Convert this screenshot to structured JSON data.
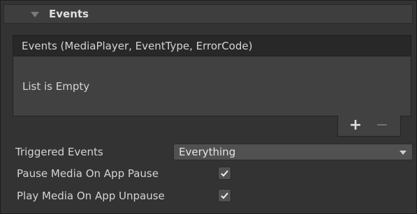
{
  "foldout": {
    "title": "Events",
    "expanded": true,
    "icon": "triangle-down-icon"
  },
  "events_list": {
    "header": "Events (MediaPlayer, EventType, ErrorCode)",
    "empty_text": "List is Empty",
    "add_label": "+",
    "remove_label": "−"
  },
  "properties": {
    "triggered_events": {
      "label": "Triggered Events",
      "value": "Everything"
    },
    "pause_on_app_pause": {
      "label": "Pause Media On App Pause",
      "checked": true
    },
    "play_on_app_unpause": {
      "label": "Play Media On App Unpause",
      "checked": true
    }
  },
  "colors": {
    "background": "#333333",
    "header_background": "#3e3e3e",
    "list_background": "#414141",
    "field_background": "#515151",
    "text": "#d4d4d4"
  }
}
